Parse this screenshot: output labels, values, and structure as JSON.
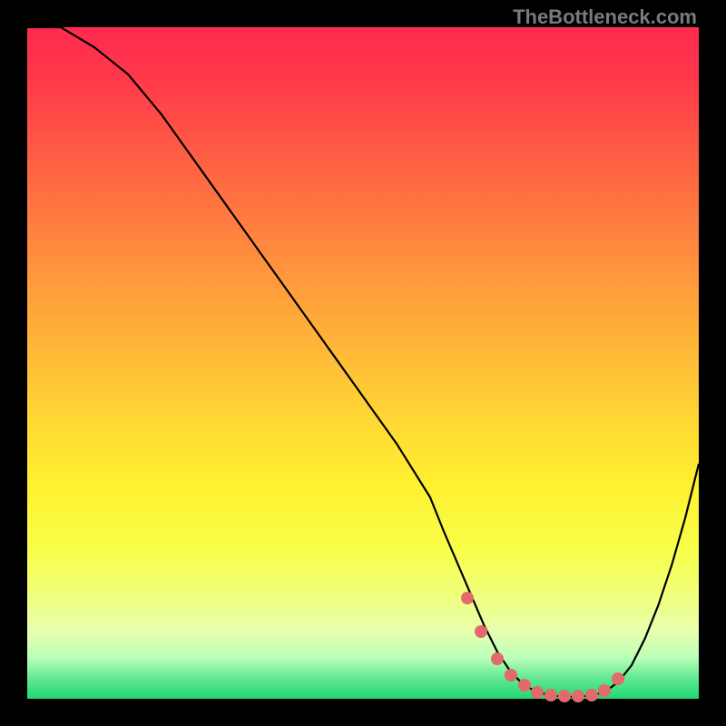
{
  "watermark": "TheBottleneck.com",
  "chart_data": {
    "type": "line",
    "title": "",
    "xlabel": "",
    "ylabel": "",
    "xlim": [
      0,
      100
    ],
    "ylim": [
      0,
      100
    ],
    "grid": false,
    "legend": false,
    "series": [
      {
        "name": "curve",
        "x": [
          0,
          5,
          10,
          15,
          20,
          25,
          30,
          35,
          40,
          45,
          50,
          55,
          60,
          62,
          65,
          68,
          70,
          72,
          74,
          76,
          78,
          80,
          82,
          84,
          86,
          88,
          90,
          92,
          94,
          96,
          98,
          100
        ],
        "values": [
          100,
          100,
          97,
          93,
          87,
          80,
          73,
          66,
          59,
          52,
          45,
          38,
          30,
          25,
          18,
          11,
          7,
          4,
          2,
          1,
          0.5,
          0.3,
          0.3,
          0.5,
          1,
          2.5,
          5,
          9,
          14,
          20,
          27,
          35
        ]
      }
    ],
    "markers": {
      "name": "highlight-dots",
      "x": [
        65.5,
        67.5,
        70,
        72,
        74,
        76,
        78,
        80,
        82,
        84,
        86,
        88
      ],
      "values": [
        15,
        10,
        6,
        3.5,
        2,
        1,
        0.6,
        0.4,
        0.4,
        0.6,
        1.2,
        3
      ]
    }
  }
}
